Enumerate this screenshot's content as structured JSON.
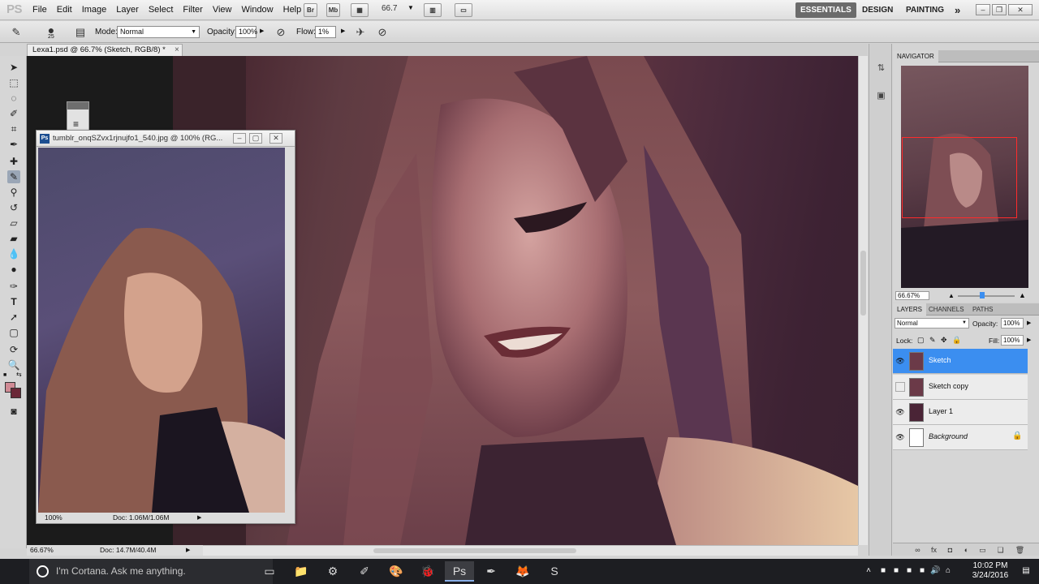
{
  "app": {
    "logo_text": "PS",
    "menu": [
      "File",
      "Edit",
      "Image",
      "Layer",
      "Select",
      "Filter",
      "View",
      "Window",
      "Help"
    ],
    "bridge_label": "Br",
    "minibridge_label": "Mb",
    "zoom_level": "66.7",
    "workspaces": [
      "ESSENTIALS",
      "DESIGN",
      "PAINTING"
    ],
    "overflow": "»"
  },
  "options_bar": {
    "brush_size": "25",
    "mode_label": "Mode:",
    "mode_value": "Normal",
    "opacity_label": "Opacity:",
    "opacity_value": "100%",
    "flow_label": "Flow:",
    "flow_value": "1%"
  },
  "document": {
    "tab_title": "Lexa1.psd @ 66.7% (Sketch, RGB/8) *",
    "tab_close": "×",
    "status_zoom": "66.67%",
    "status_doc": "Doc: 14.7M/40.4M"
  },
  "reference_window": {
    "title": "tumblr_onqSZvx1rjnujfo1_540.jpg @ 100% (RG...",
    "status_zoom": "100%",
    "status_doc": "Doc: 1.06M/1.06M"
  },
  "navigator": {
    "tab": "NAVIGATOR",
    "zoom": "66.67%"
  },
  "layers_panel": {
    "tabs": [
      "LAYERS",
      "CHANNELS",
      "PATHS"
    ],
    "blend_mode": "Normal",
    "opacity_label": "Opacity:",
    "opacity_value": "100%",
    "lock_label": "Lock:",
    "fill_label": "Fill:",
    "fill_value": "100%",
    "layers": [
      {
        "name": "Sketch",
        "visible": true,
        "selected": true
      },
      {
        "name": "Sketch copy",
        "visible": false,
        "selected": false
      },
      {
        "name": "Layer 1",
        "visible": true,
        "selected": false
      },
      {
        "name": "Background",
        "visible": true,
        "selected": false,
        "locked": true
      }
    ]
  },
  "taskbar": {
    "cortana_placeholder": "I'm Cortana. Ask me anything.",
    "time": "10:02 PM",
    "date": "3/24/2016"
  },
  "colors": {
    "foreground": "#d08a94",
    "background": "#6b2838",
    "selection": "#3b8ef0",
    "navigator_box": "#ff2b2b"
  }
}
